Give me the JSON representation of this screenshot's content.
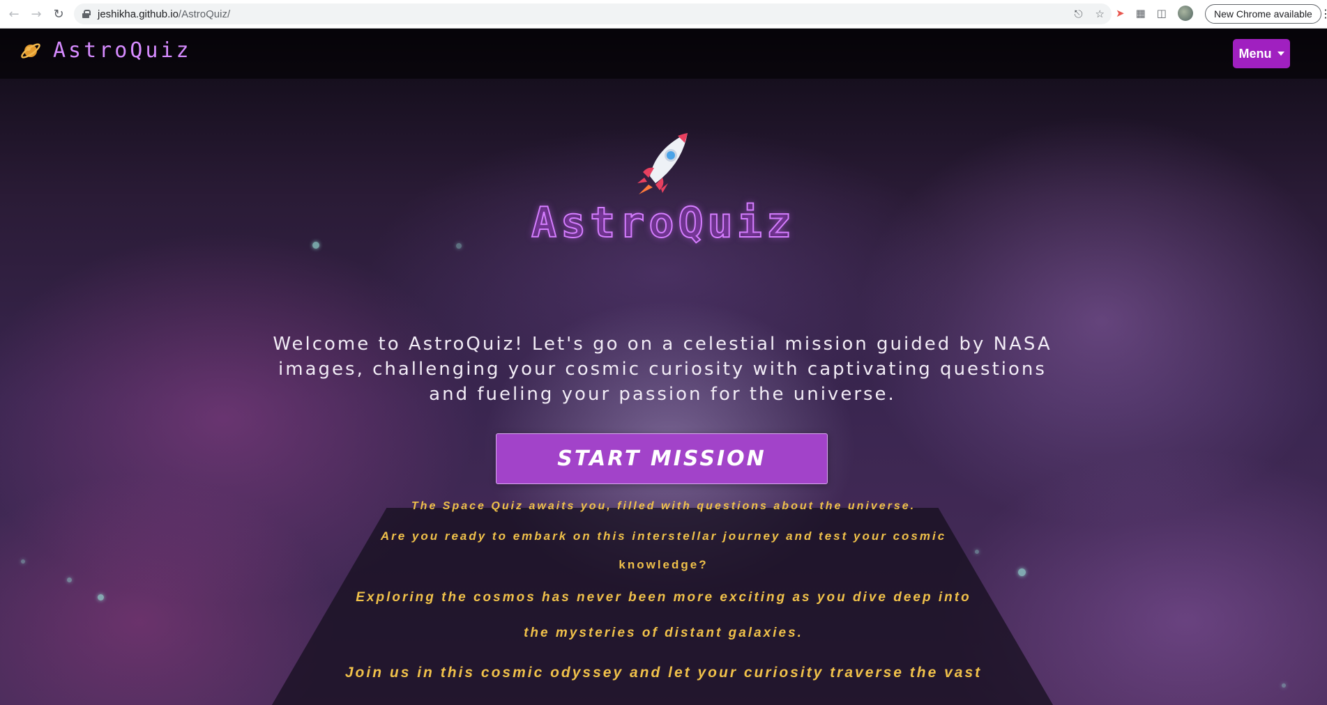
{
  "browser": {
    "url_host": "jeshikha.github.io",
    "url_path": "/AstroQuiz/",
    "update_pill": "New Chrome available"
  },
  "navbar": {
    "brand": "AstroQuiz",
    "menu_label": "Menu"
  },
  "hero": {
    "title": "AstroQuiz",
    "welcome": "Welcome to AstroQuiz! Let's go on a celestial mission guided by NASA images, challenging your cosmic curiosity with captivating questions and fueling your passion for the universe.",
    "start_button": "START MISSION"
  },
  "crawl": {
    "lines": [
      "The Space Quiz awaits you, filled with questions about the universe.",
      "Are you ready to embark on this interstellar journey and test your cosmic",
      "knowledge?",
      "Exploring the cosmos has never been more exciting as you dive deep into",
      "the mysteries of distant galaxies.",
      "Join us in this cosmic odyssey and let your curiosity traverse the vast"
    ]
  },
  "colors": {
    "accent": "#a020c0",
    "brand_text": "#d68bff",
    "crawl_text": "#f0c14a",
    "button": "#a243c9"
  },
  "icons": {
    "back": "arrow-left-icon",
    "forward": "arrow-right-icon",
    "reload": "reload-icon",
    "share": "share-icon",
    "bookmark": "star-icon",
    "extensions": "puzzle-icon",
    "sidepanel": "sidepanel-icon",
    "brand": "ringed-planet-icon",
    "hero": "rocket-icon"
  }
}
